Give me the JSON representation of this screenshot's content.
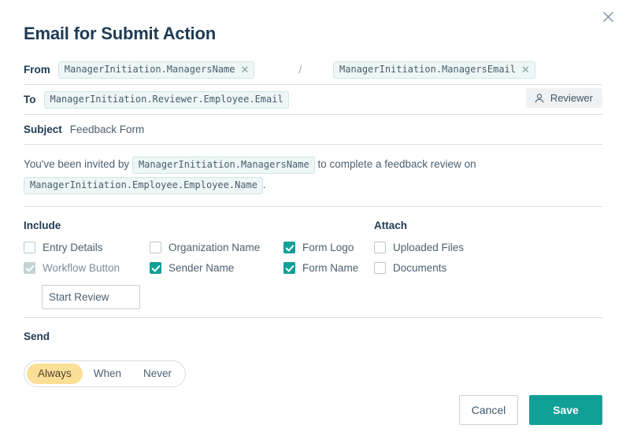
{
  "dialog": {
    "title": "Email for Submit Action",
    "close_icon": "close-icon"
  },
  "from": {
    "label": "From",
    "name_token": "ManagerInitiation.ManagersName",
    "separator": "/",
    "email_token": "ManagerInitiation.ManagersEmail",
    "remove_glyph": "✕"
  },
  "to": {
    "label": "To",
    "token": "ManagerInitiation.Reviewer.Employee.Email",
    "reviewer_button": "Reviewer",
    "reviewer_icon": "person-icon"
  },
  "subject": {
    "label": "Subject",
    "value": "Feedback Form"
  },
  "body": {
    "text_before": "You've been invited by",
    "token_1": "ManagerInitiation.ManagersName",
    "text_middle": "to complete a feedback review on",
    "token_2": "ManagerInitiation.Employee.Employee.Name",
    "text_after": "."
  },
  "include": {
    "heading": "Include",
    "items": [
      {
        "label": "Entry Details",
        "checked": false,
        "disabled": false
      },
      {
        "label": "Organization Name",
        "checked": false,
        "disabled": false
      },
      {
        "label": "Form Logo",
        "checked": true,
        "disabled": false
      },
      {
        "label": "Workflow Button",
        "checked": true,
        "disabled": true
      },
      {
        "label": "Sender Name",
        "checked": true,
        "disabled": false
      },
      {
        "label": "Form Name",
        "checked": true,
        "disabled": false
      }
    ],
    "workflow_button_text": "Start Review"
  },
  "attach": {
    "heading": "Attach",
    "items": [
      {
        "label": "Uploaded Files",
        "checked": false
      },
      {
        "label": "Documents",
        "checked": false
      }
    ]
  },
  "send": {
    "heading": "Send",
    "options": [
      "Always",
      "When",
      "Never"
    ],
    "selected": "Always"
  },
  "footer": {
    "cancel_label": "Cancel",
    "save_label": "Save"
  },
  "colors": {
    "accent": "#11a098",
    "title": "#1f3b54",
    "chip_bg": "#edf7f6",
    "chip_border": "#cfe7e4",
    "highlight": "#fcdf96",
    "divider": "#d9e1e2"
  }
}
